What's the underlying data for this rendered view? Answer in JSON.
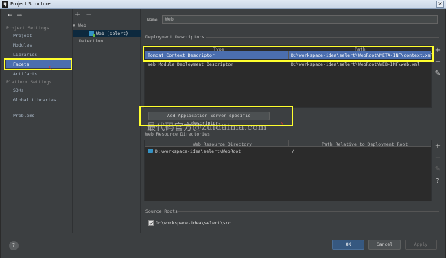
{
  "window": {
    "title": "Project Structure",
    "app_icon_glyph": "IJ",
    "close_glyph": "×"
  },
  "nav": {
    "back_glyph": "←",
    "forward_glyph": "→",
    "project_settings_heading": "Project Settings",
    "project_items": [
      "Project",
      "Modules",
      "Libraries",
      "Facets",
      "Artifacts"
    ],
    "selected_item": "Facets",
    "platform_settings_heading": "Platform Settings",
    "platform_items": [
      "SDKs",
      "Global Libraries"
    ],
    "problems": "Problems"
  },
  "tree": {
    "add_glyph": "+",
    "remove_glyph": "−",
    "root_arrow": "▼",
    "root_label": "Web",
    "child_label": "Web (selert)",
    "detection_label": "Detection"
  },
  "facet": {
    "name_label": "Name:",
    "name_value": "Web",
    "deployment_descriptors_label": "Deployment Descriptors",
    "dd_columns": {
      "type": "Type",
      "path": "Path"
    },
    "dd_rows": [
      {
        "type": "Tomcat Context Descriptor",
        "path": "D:\\workspace-idea\\selert\\WebRoot\\META-INF\\context.xml"
      },
      {
        "type": "Web Module Deployment Descriptor",
        "path": "D:\\workspace-idea\\selert\\WebRoot\\WEB-INF\\web.xml"
      }
    ],
    "add_server_descriptor_button": "Add Application Server specific descriptor...",
    "watermark": "最代码官方@zuidaima.com",
    "web_resource_dirs_label": "Web Resource Directories",
    "wr_columns": {
      "dir": "Web Resource Directory",
      "path": "Path Relative to Deployment Root"
    },
    "wr_rows": [
      {
        "dir": "D:\\workspace-idea\\selert\\WebRoot",
        "path": "/"
      }
    ],
    "source_roots_label": "Source Roots",
    "source_roots": [
      "D:\\workspace-idea\\selert\\src"
    ]
  },
  "side_tools": {
    "add": "+",
    "remove": "−",
    "edit": "✎",
    "help": "?"
  },
  "footer": {
    "help_glyph": "?",
    "ok": "OK",
    "cancel": "Cancel",
    "apply": "Apply"
  },
  "icons": {
    "app": "intellij-icon",
    "web_facet": "web-facet-icon",
    "folder": "folder-icon",
    "checkbox": "checkbox-checked-icon"
  },
  "colors": {
    "background": "#3c3f41",
    "selection": "#4b6eaf",
    "ok_button": "#365880",
    "highlight": "#ffff2e"
  }
}
